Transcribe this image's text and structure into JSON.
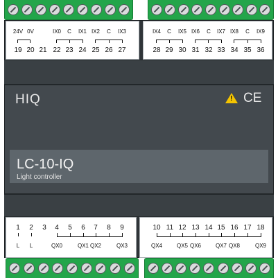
{
  "brand": "HIQ",
  "model": "LC-10-IQ",
  "description": "Light controller",
  "certification": "CE",
  "warning_symbol": "!",
  "colors": {
    "terminal": "#23a54a",
    "housing": "#2f3438",
    "front": "#43494e",
    "plate": "#5e666c"
  },
  "top_terminals": {
    "left": {
      "labels": [
        "24V",
        "0V",
        "",
        "IX0",
        "C",
        "IX1",
        "IX2",
        "C",
        "IX3"
      ],
      "numbers": [
        "19",
        "20",
        "21",
        "22",
        "23",
        "24",
        "25",
        "26",
        "27"
      ]
    },
    "right": {
      "labels": [
        "IX4",
        "C",
        "IX5",
        "IX6",
        "C",
        "IX7",
        "IX8",
        "C",
        "IX9"
      ],
      "numbers": [
        "28",
        "29",
        "30",
        "31",
        "32",
        "33",
        "34",
        "35",
        "36"
      ]
    }
  },
  "bottom_terminals": {
    "left": {
      "numbers": [
        "1",
        "2",
        "3",
        "4",
        "5",
        "6",
        "7",
        "8",
        "9"
      ],
      "labels": [
        "L",
        "L",
        "",
        "QX0",
        "",
        "QX1",
        "QX2",
        "",
        "QX3"
      ]
    },
    "right": {
      "numbers": [
        "10",
        "11",
        "12",
        "13",
        "14",
        "15",
        "16",
        "17",
        "18"
      ],
      "labels": [
        "QX4",
        "",
        "QX5",
        "QX6",
        "",
        "QX7",
        "QX8",
        "",
        "QX9"
      ]
    }
  }
}
